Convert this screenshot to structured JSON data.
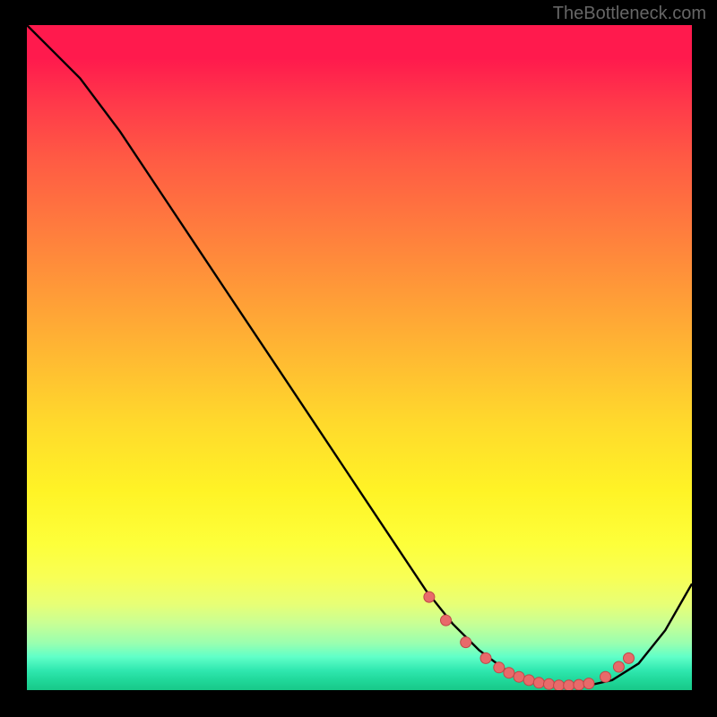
{
  "watermark": "TheBottleneck.com",
  "chart_data": {
    "type": "line",
    "title": "",
    "xlabel": "",
    "ylabel": "",
    "xlim": [
      0,
      100
    ],
    "ylim": [
      0,
      100
    ],
    "grid": false,
    "series": [
      {
        "name": "curve",
        "x": [
          0,
          4,
          8,
          14,
          20,
          26,
          32,
          38,
          44,
          50,
          56,
          60,
          64,
          68,
          72,
          76,
          80,
          84,
          88,
          92,
          96,
          100
        ],
        "y": [
          100,
          96,
          92,
          84,
          75,
          66,
          57,
          48,
          39,
          30,
          21,
          15,
          10,
          6,
          3,
          1.2,
          0.6,
          0.6,
          1.5,
          4,
          9,
          16
        ]
      }
    ],
    "markers": {
      "name": "dots",
      "x": [
        60.5,
        63,
        66,
        69,
        71,
        72.5,
        74,
        75.5,
        77,
        78.5,
        80,
        81.5,
        83,
        84.5,
        87,
        89,
        90.5
      ],
      "y": [
        14,
        10.5,
        7.2,
        4.8,
        3.4,
        2.6,
        2.0,
        1.5,
        1.1,
        0.9,
        0.7,
        0.7,
        0.8,
        1.0,
        2.0,
        3.5,
        4.8
      ]
    },
    "colors": {
      "line": "#000000",
      "marker_fill": "#e86a6a",
      "marker_stroke": "#c04848"
    }
  }
}
